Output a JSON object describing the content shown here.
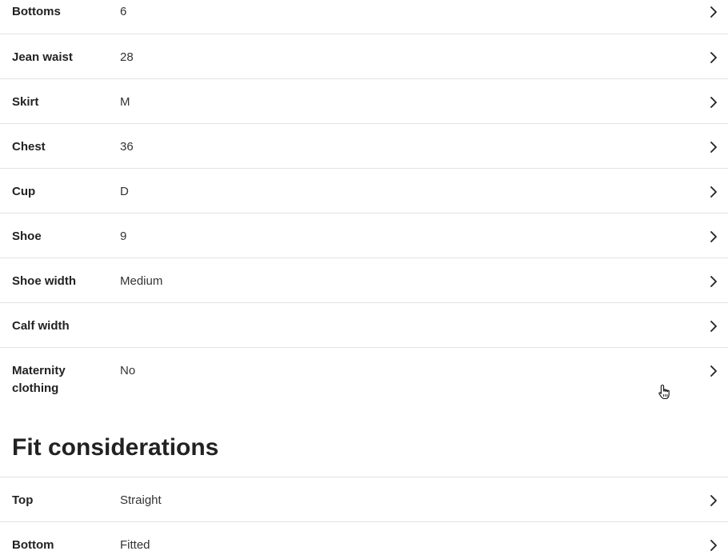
{
  "sizes": {
    "items": [
      {
        "label": "Bottoms",
        "value": "6"
      },
      {
        "label": "Jean waist",
        "value": "28"
      },
      {
        "label": "Skirt",
        "value": "M"
      },
      {
        "label": "Chest",
        "value": "36"
      },
      {
        "label": "Cup",
        "value": "D"
      },
      {
        "label": "Shoe",
        "value": "9"
      },
      {
        "label": "Shoe width",
        "value": "Medium"
      },
      {
        "label": "Calf width",
        "value": ""
      },
      {
        "label": "Maternity clothing",
        "value": "No"
      }
    ]
  },
  "fit": {
    "title": "Fit considerations",
    "items": [
      {
        "label": "Top",
        "value": "Straight"
      },
      {
        "label": "Bottom",
        "value": "Fitted"
      }
    ]
  },
  "icons": {
    "row_chevron": "chevron-right-icon",
    "pointer": "hand-pointer-cursor-icon"
  },
  "colors": {
    "text": "#222222",
    "divider": "#e3e3e3",
    "background": "#ffffff"
  }
}
